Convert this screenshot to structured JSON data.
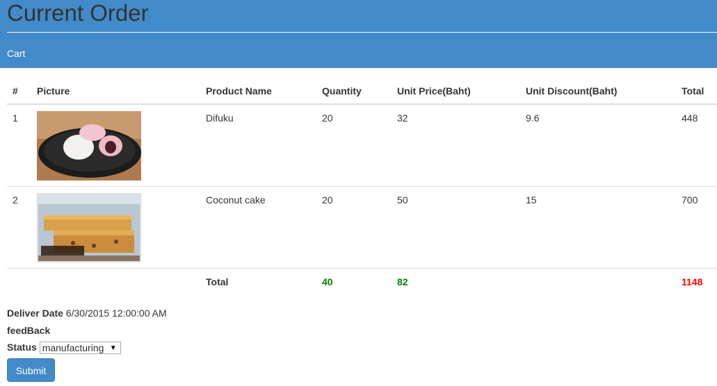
{
  "header": {
    "title": "Current Order",
    "breadcrumb": "Cart"
  },
  "table": {
    "columns": [
      "#",
      "Picture",
      "Product Name",
      "Quantity",
      "Unit Price(Baht)",
      "Unit Discount(Baht)",
      "Total"
    ],
    "rows": [
      {
        "num": "1",
        "image": "daifuku-photo",
        "name": "Difuku",
        "quantity": "20",
        "unit_price": "32",
        "unit_discount": "9.6",
        "total": "448"
      },
      {
        "num": "2",
        "image": "coconut-cake-photo",
        "name": "Coconut cake",
        "quantity": "20",
        "unit_price": "50",
        "unit_discount": "15",
        "total": "700"
      }
    ],
    "totals": {
      "label": "Total",
      "quantity": "40",
      "unit_price": "82",
      "total": "1148"
    }
  },
  "order": {
    "deliver_date_label": "Deliver Date",
    "deliver_date": "6/30/2015 12:00:00 AM",
    "feedback_label": "feedBack",
    "status_label": "Status",
    "status_value": "manufacturing"
  },
  "actions": {
    "submit_label": "Submit"
  },
  "colors": {
    "header_bg": "#428bca",
    "total_green": "#008000",
    "grand_total_red": "#ff0000"
  }
}
